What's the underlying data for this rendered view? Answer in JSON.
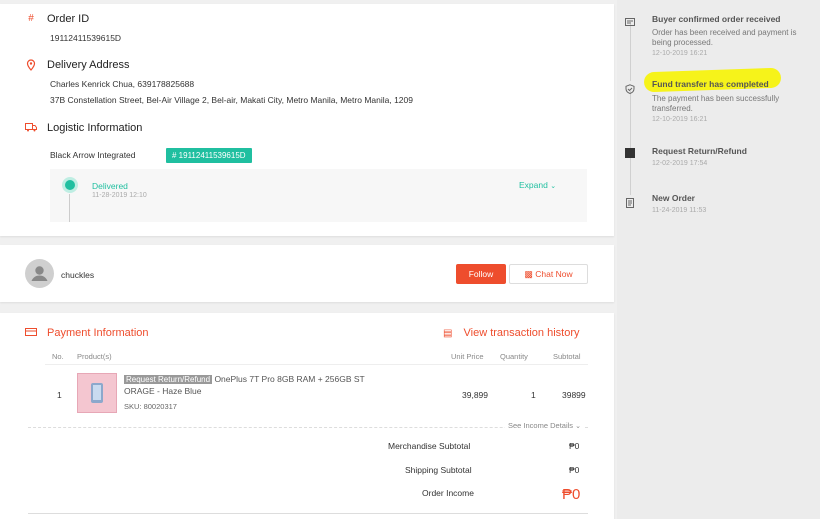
{
  "order": {
    "id_label": "Order ID",
    "id_value": "19112411539615D",
    "address_label": "Delivery Address",
    "address_name": "Charles Kenrick Chua, 639178825688",
    "address_line": "37B Constellation Street, Bel-Air Village 2, Bel-air, Makati City, Metro Manila, Metro Manila, 1209",
    "logistic_label": "Logistic Information",
    "carrier": "Black Arrow Integrated",
    "tracking": "# 19112411539615D",
    "status": "Delivered",
    "status_date": "11-28-2019 12:10",
    "expand_label": "Expand"
  },
  "buyer": {
    "name": "chuckles",
    "follow_label": "Follow",
    "chat_label": "Chat Now"
  },
  "payment": {
    "title": "Payment Information",
    "history_label": "View transaction history",
    "columns": {
      "no": "No.",
      "products": "Product(s)",
      "unit_price": "Unit Price",
      "quantity": "Quantity",
      "subtotal": "Subtotal"
    },
    "item": {
      "no": "1",
      "tag": "Request Return/Refund",
      "name_1": "OnePlus 7T Pro 8GB RAM + 256GB ST",
      "name_2": "ORAGE - Haze Blue",
      "sku": "SKU: 80020317",
      "unit_price": "39,899",
      "quantity": "1",
      "subtotal": "39899"
    },
    "see_income": "See Income Details",
    "merch_label": "Merchandise Subtotal",
    "merch_value": "₱0",
    "shipping_label": "Shipping Subtotal",
    "shipping_value": "₱0",
    "income_label": "Order Income",
    "income_value": "₱0"
  },
  "timeline": [
    {
      "title": "Buyer confirmed order received",
      "desc": "Order has been received and payment is being processed.",
      "date": "12-10-2019 16:21"
    },
    {
      "title": "Fund transfer has completed",
      "desc": "The payment has been successfully transferred.",
      "date": "12-10-2019 16:21"
    },
    {
      "title": "Request Return/Refund",
      "desc": "",
      "date": "12-02-2019 17:54"
    },
    {
      "title": "New Order",
      "desc": "",
      "date": "11-24-2019 11:53"
    }
  ],
  "colors": {
    "accent": "#ee4d2d",
    "teal": "#20bfa0",
    "highlight": "#f6f31a"
  }
}
